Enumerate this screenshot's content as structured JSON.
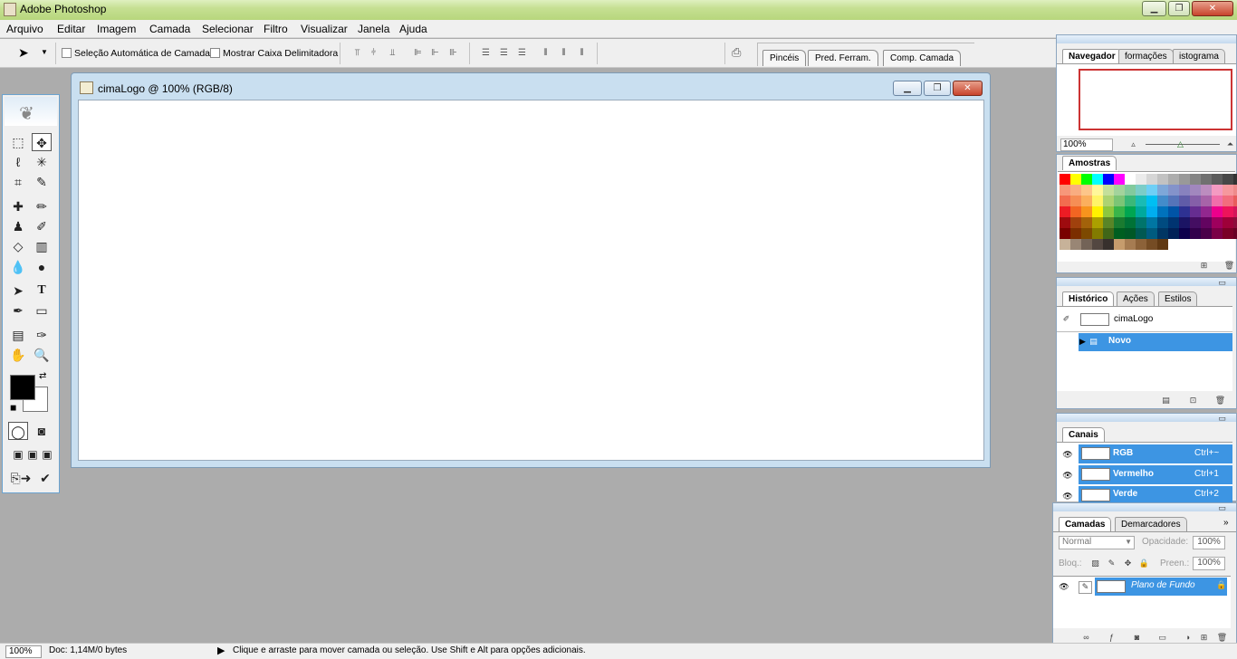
{
  "window": {
    "title": "Adobe Photoshop",
    "controls": [
      "minimize-icon",
      "maximize-icon",
      "close-icon"
    ]
  },
  "menu": [
    "Arquivo",
    "Editar",
    "Imagem",
    "Camada",
    "Selecionar",
    "Filtro",
    "Visualizar",
    "Janela",
    "Ajuda"
  ],
  "options": {
    "auto_select_label": "Seleção Automática de Camada",
    "show_bounds_label": "Mostrar Caixa Delimitadora",
    "well_tabs": [
      "Pincéis",
      "Pred. Ferram.",
      "Comp. Camada"
    ]
  },
  "document": {
    "title": "cimaLogo @ 100% (RGB/8)"
  },
  "navigator": {
    "tabs": [
      "Navegador",
      "formações",
      "istograma"
    ],
    "zoom": "100%"
  },
  "swatches": {
    "title": "Amostras",
    "colors": [
      [
        "#ff0000",
        "#ffff00",
        "#00ff00",
        "#00ffff",
        "#0000ff",
        "#ff00ff",
        "#ffffff",
        "#ebebeb",
        "#d6d6d6",
        "#c2c2c2",
        "#adadad",
        "#999999",
        "#858585",
        "#707070",
        "#5c5c5c",
        "#474747",
        "#333333",
        "#1f1f1f",
        "#000000"
      ],
      [
        "#f7977a",
        "#f9ad81",
        "#fdc68a",
        "#fff79a",
        "#c4df9b",
        "#a3d39c",
        "#82ca9d",
        "#7bcdc8",
        "#6ecff6",
        "#7ea7d8",
        "#8493ca",
        "#8882be",
        "#a187be",
        "#bc8dbf",
        "#f49ac2",
        "#f6989d",
        "#ee8b8b",
        "#e58a8a",
        "#da7f7f"
      ],
      [
        "#f26c4f",
        "#f68e55",
        "#fbaf5d",
        "#fff467",
        "#acd372",
        "#7cc576",
        "#3bb878",
        "#1abbb4",
        "#00bff3",
        "#438cca",
        "#5574b9",
        "#605ca8",
        "#855fa8",
        "#a763a8",
        "#f06eaa",
        "#f26d7d",
        "#e85c5c",
        "#d94b4b",
        "#c93a3a"
      ],
      [
        "#ed1c24",
        "#f26522",
        "#f7941d",
        "#fff200",
        "#8dc73f",
        "#39b54a",
        "#00a651",
        "#00a99d",
        "#00aeef",
        "#0072bc",
        "#0054a6",
        "#2e3192",
        "#662d91",
        "#92278f",
        "#ec008c",
        "#ed145b",
        "#d4145a",
        "#c1272d",
        "#a91e23"
      ],
      [
        "#9e0b0f",
        "#a0410d",
        "#a3620a",
        "#aba000",
        "#598527",
        "#1a7b30",
        "#007236",
        "#00746b",
        "#0076a3",
        "#004b80",
        "#003471",
        "#1b1464",
        "#440e62",
        "#630460",
        "#9e005d",
        "#9e0039",
        "#8c0c3b",
        "#7a0c2e",
        "#690a26"
      ],
      [
        "#790000",
        "#7b2e00",
        "#7d4900",
        "#827b00",
        "#406618",
        "#005e20",
        "#005826",
        "#005952",
        "#005b7f",
        "#003663",
        "#002157",
        "#0d004c",
        "#32004b",
        "#4b0049",
        "#7b0046",
        "#7a0026",
        "#690024",
        "#58001c",
        "#470016"
      ],
      [
        "#c7b299",
        "#998675",
        "#736357",
        "#534741",
        "#37302d",
        "#c69c6d",
        "#a67c52",
        "#8c6239",
        "#754c24",
        "#603913"
      ]
    ]
  },
  "history": {
    "tabs": [
      "Histórico",
      "Ações",
      "Estilos"
    ],
    "items": [
      {
        "label": "cimaLogo",
        "selected": false
      },
      {
        "label": "Novo",
        "selected": true
      }
    ]
  },
  "channels": {
    "tabs": [
      "Canais"
    ],
    "items": [
      {
        "name": "RGB",
        "shortcut": "Ctrl+~"
      },
      {
        "name": "Vermelho",
        "shortcut": "Ctrl+1"
      },
      {
        "name": "Verde",
        "shortcut": "Ctrl+2"
      }
    ]
  },
  "layers": {
    "tabs": [
      "Camadas",
      "Demarcadores"
    ],
    "blend_mode": "Normal",
    "opacity_label": "Opacidade:",
    "opacity": "100%",
    "lock_label": "Bloq.:",
    "fill_label": "Preen.:",
    "fill": "100%",
    "items": [
      {
        "name": "Plano de Fundo",
        "selected": true
      }
    ]
  },
  "status": {
    "zoom": "100%",
    "doc": "Doc: 1,14M/0 bytes",
    "message": "Clique e arraste para mover camada ou seleção.  Use Shift e Alt para opções adicionais."
  }
}
